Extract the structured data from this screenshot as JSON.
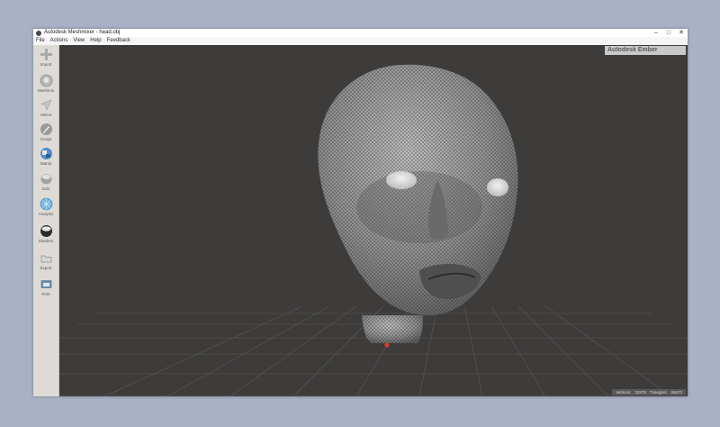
{
  "window": {
    "title": "Autodesk Meshmixer - head.obj",
    "controls": {
      "minimize": "–",
      "maximize": "□",
      "close": "✕"
    }
  },
  "menu": [
    "File",
    "Actions",
    "View",
    "Help",
    "Feedback"
  ],
  "tools": [
    {
      "label": "Import",
      "icon": "plus-icon"
    },
    {
      "label": "Meshmix",
      "icon": "meshmix-icon"
    },
    {
      "label": "Select",
      "icon": "select-arrow-icon"
    },
    {
      "label": "Sculpt",
      "icon": "brush-icon"
    },
    {
      "label": "Stamp",
      "icon": "stamp-icon"
    },
    {
      "label": "Edit",
      "icon": "edit-icon"
    },
    {
      "label": "Analysis",
      "icon": "analysis-icon"
    },
    {
      "label": "Shaders",
      "icon": "shader-sphere-icon"
    },
    {
      "label": "Export",
      "icon": "export-icon"
    },
    {
      "label": "Print",
      "icon": "print-icon"
    }
  ],
  "viewport": {
    "brand_label": "Autodesk Ember",
    "status": {
      "vertices_label": "Vertices:",
      "vertices": "32879",
      "triangles_label": "Triangles:",
      "triangles": "65670"
    }
  },
  "colors": {
    "desktop": "#a9b1c6",
    "viewport_bg": "#3d3c3b",
    "mesh": "#8c8c8c",
    "pivot": "#e0392b"
  }
}
